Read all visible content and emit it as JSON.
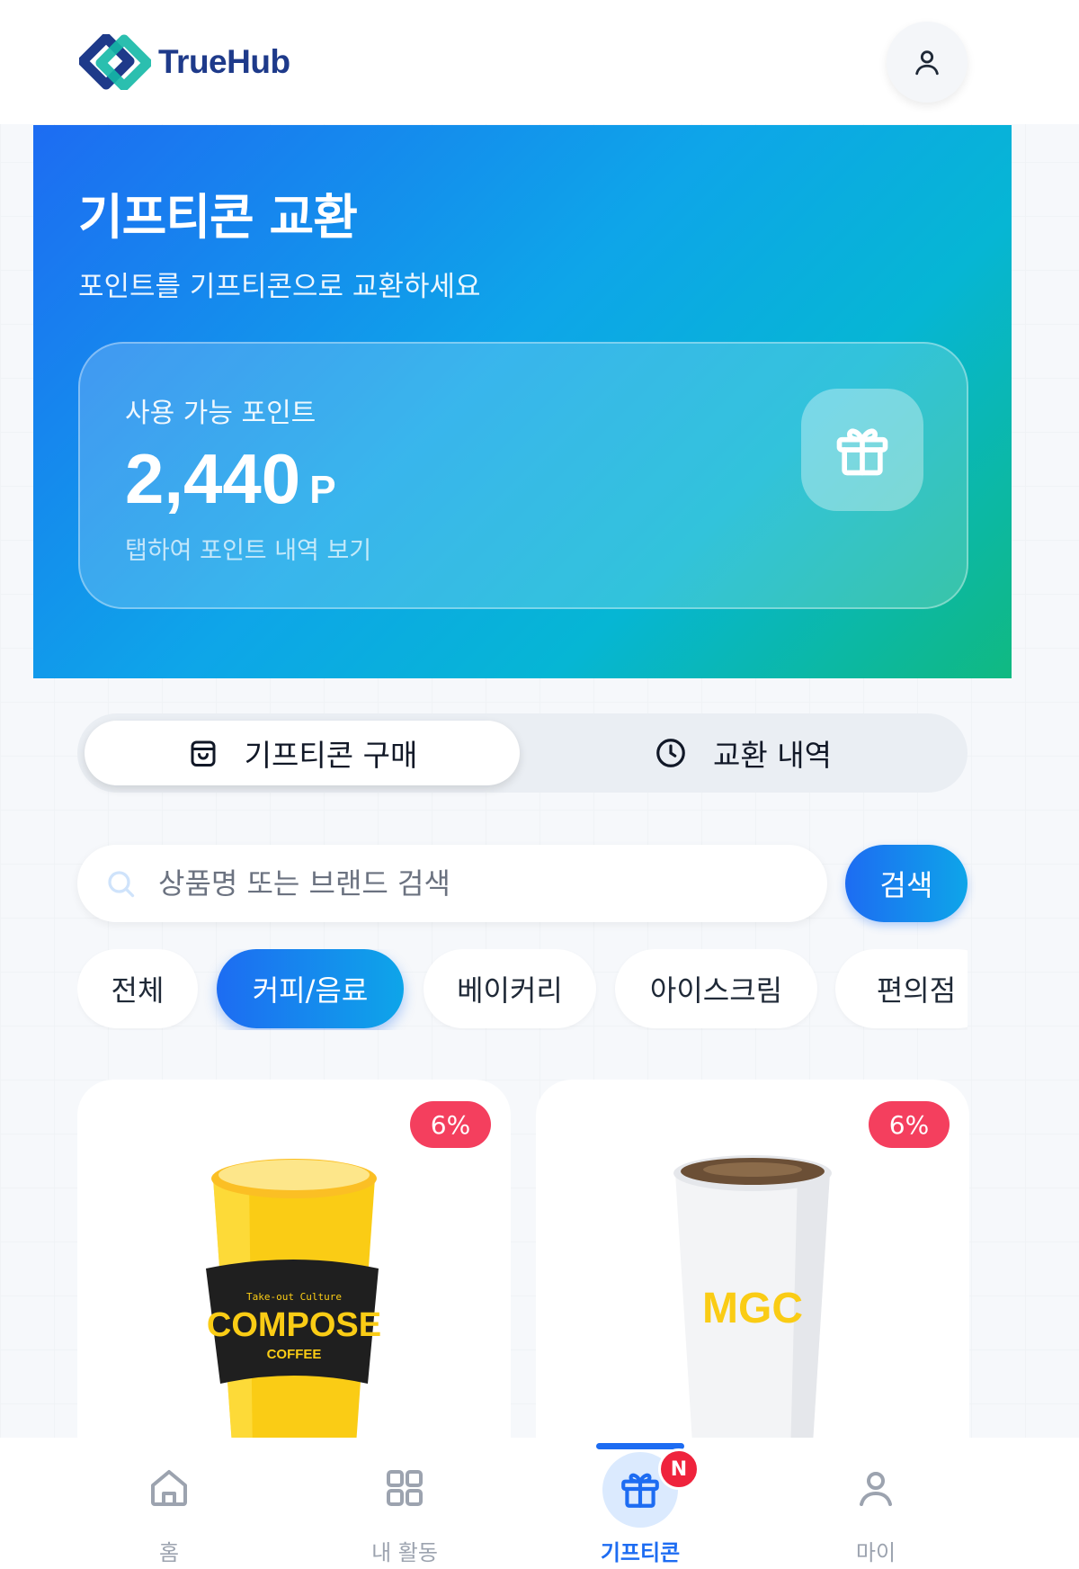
{
  "app": {
    "name": "TrueHub"
  },
  "hero": {
    "title": "기프티콘 교환",
    "subtitle": "포인트를 기프티콘으로 교환하세요",
    "points_label": "사용 가능 포인트",
    "points_value": "2,440",
    "points_unit": "P",
    "points_hint": "탭하여 포인트 내역 보기"
  },
  "segment": {
    "tabs": [
      {
        "label": "기프티콘 구매",
        "icon": "shopping-bag-icon",
        "active": true
      },
      {
        "label": "교환 내역",
        "icon": "clock-icon",
        "active": false
      }
    ]
  },
  "search": {
    "placeholder": "상품명 또는 브랜드 검색",
    "value": "",
    "button_label": "검색"
  },
  "categories": [
    {
      "label": "전체",
      "active": false
    },
    {
      "label": "커피/음료",
      "active": true
    },
    {
      "label": "베이커리",
      "active": false
    },
    {
      "label": "아이스크림",
      "active": false
    },
    {
      "label": "편의점",
      "active": false
    }
  ],
  "products": [
    {
      "discount": "6%",
      "cup_sleeve_top": "Take-out Culture",
      "cup_brand": "COMPOSE",
      "cup_sub": "COFFEE"
    },
    {
      "discount": "6%",
      "cup_brand": "MGC"
    }
  ],
  "bottom_nav": [
    {
      "label": "홈",
      "icon": "home-icon",
      "active": false
    },
    {
      "label": "내 활동",
      "icon": "grid-icon",
      "active": false
    },
    {
      "label": "기프티콘",
      "icon": "gift-icon",
      "active": true,
      "badge": "N"
    },
    {
      "label": "마이",
      "icon": "user-icon",
      "active": false
    }
  ],
  "colors": {
    "primary": "#1d6cf2",
    "accent_green": "#10b981",
    "badge_red": "#f43f5e"
  }
}
